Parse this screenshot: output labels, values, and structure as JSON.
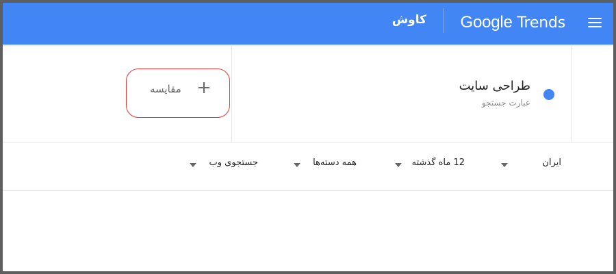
{
  "app": {
    "brand_google": "Google",
    "brand_trends": "Trends",
    "explore_label": "کاوش",
    "menu_icon": "hamburger-menu-icon"
  },
  "search_term": {
    "title": "طراحی سایت",
    "subtitle": "عبارت جستجو",
    "dot_color": "#4285f4"
  },
  "compare": {
    "label": "مقایسه",
    "icon": "plus-icon"
  },
  "filters": {
    "country": "ایران",
    "time_range": "12 ماه گذشته",
    "category": "همه دسته‌ها",
    "search_type": "جستجوی وب"
  },
  "colors": {
    "accent": "#4285f4",
    "highlight": "#e53935"
  }
}
